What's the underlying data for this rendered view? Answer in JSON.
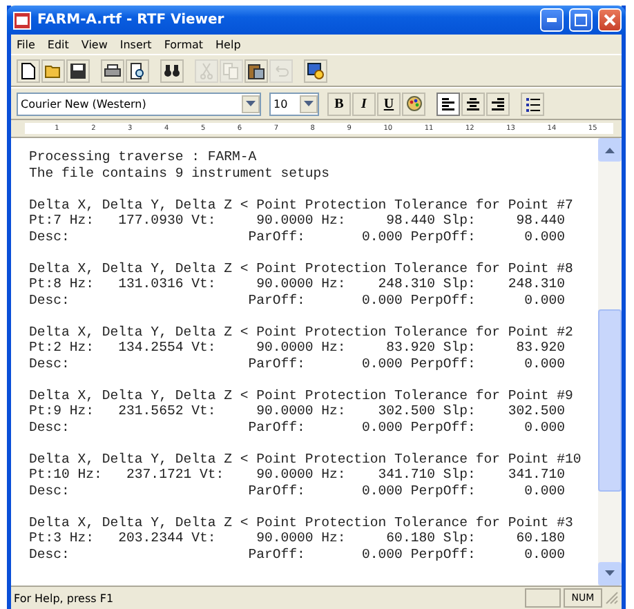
{
  "window": {
    "title": "FARM-A.rtf - RTF Viewer"
  },
  "menu": [
    "File",
    "Edit",
    "View",
    "Insert",
    "Format",
    "Help"
  ],
  "toolbar": [
    {
      "kind": "new",
      "disabled": false
    },
    {
      "kind": "open",
      "disabled": false
    },
    {
      "kind": "save",
      "disabled": false
    },
    {
      "kind": "sep"
    },
    {
      "kind": "print",
      "disabled": false
    },
    {
      "kind": "preview",
      "disabled": false
    },
    {
      "kind": "sep"
    },
    {
      "kind": "find",
      "disabled": false
    },
    {
      "kind": "sep"
    },
    {
      "kind": "cut",
      "disabled": true
    },
    {
      "kind": "copy",
      "disabled": true
    },
    {
      "kind": "paste",
      "disabled": false
    },
    {
      "kind": "undo",
      "disabled": true
    },
    {
      "kind": "sep"
    },
    {
      "kind": "object",
      "disabled": false
    }
  ],
  "format_bar": {
    "font": "Courier New (Western)",
    "size": "10",
    "styles": [
      {
        "kind": "bold",
        "label": "B"
      },
      {
        "kind": "italic",
        "label": "I"
      },
      {
        "kind": "underline",
        "label": "U"
      },
      {
        "kind": "color"
      }
    ],
    "align": [
      {
        "kind": "left",
        "selected": true
      },
      {
        "kind": "center",
        "selected": false
      },
      {
        "kind": "right",
        "selected": false
      }
    ]
  },
  "ruler": {
    "labels": [
      "1",
      "2",
      "3",
      "4",
      "5",
      "6",
      "7",
      "8",
      "9",
      "10",
      "11",
      "12",
      "13",
      "14",
      "15"
    ]
  },
  "document": [
    [
      "Processing traverse : FARM-A",
      "The file contains 9 instrument setups"
    ],
    [
      "Delta X, Delta Y, Delta Z < Point Protection Tolerance for Point #7",
      "Pt:7 Hz:   177.0930 Vt:     90.0000 Hz:     98.440 Slp:     98.440",
      "Desc:                      ParOff:       0.000 PerpOff:      0.000"
    ],
    [
      "Delta X, Delta Y, Delta Z < Point Protection Tolerance for Point #8",
      "Pt:8 Hz:   131.0316 Vt:     90.0000 Hz:    248.310 Slp:    248.310",
      "Desc:                      ParOff:       0.000 PerpOff:      0.000"
    ],
    [
      "Delta X, Delta Y, Delta Z < Point Protection Tolerance for Point #2",
      "Pt:2 Hz:   134.2554 Vt:     90.0000 Hz:     83.920 Slp:     83.920",
      "Desc:                      ParOff:       0.000 PerpOff:      0.000"
    ],
    [
      "Delta X, Delta Y, Delta Z < Point Protection Tolerance for Point #9",
      "Pt:9 Hz:   231.5652 Vt:     90.0000 Hz:    302.500 Slp:    302.500",
      "Desc:                      ParOff:       0.000 PerpOff:      0.000"
    ],
    [
      "Delta X, Delta Y, Delta Z < Point Protection Tolerance for Point #10",
      "Pt:10 Hz:   237.1721 Vt:    90.0000 Hz:    341.710 Slp:    341.710",
      "Desc:                      ParOff:       0.000 PerpOff:      0.000"
    ],
    [
      "Delta X, Delta Y, Delta Z < Point Protection Tolerance for Point #3",
      "Pt:3 Hz:   203.2344 Vt:     90.0000 Hz:     60.180 Slp:     60.180",
      "Desc:                      ParOff:       0.000 PerpOff:      0.000"
    ]
  ],
  "status_bar": {
    "message": "For Help, press F1",
    "indicator": "NUM"
  }
}
